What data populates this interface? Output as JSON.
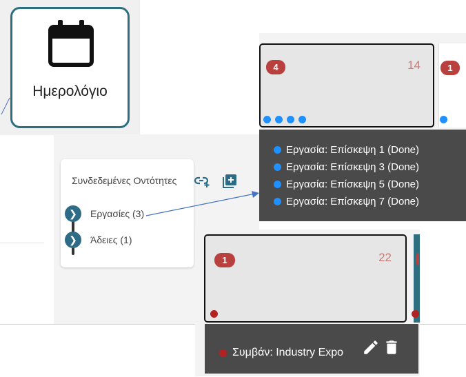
{
  "calendar_tile": {
    "label": "Ημερολόγιο",
    "icon": "calendar-icon"
  },
  "linked_entities": {
    "title": "Συνδεδεμένες Οντότητες",
    "items": [
      {
        "label": "Εργασίες (3)"
      },
      {
        "label": "Άδειες (1)"
      }
    ]
  },
  "calendar_cells": [
    {
      "badge": "4",
      "day": "14",
      "dots": 4,
      "dot_color": "#1e90ff",
      "popup": [
        "Εργασία: Επίσκεψη 1 (Done)",
        "Εργασία: Επίσκεψη 3 (Done)",
        "Εργασία: Επίσκεψη 5 (Done)",
        "Εργασία: Επίσκεψη 7 (Done)"
      ]
    },
    {
      "badge": "1",
      "day": "22",
      "dot_color": "#b22222",
      "event": "Συμβάν: Industry Expo"
    }
  ],
  "neighbor_badges": [
    "1"
  ],
  "colors": {
    "accent": "#2d6e80",
    "badge": "#b8413f",
    "task_dot": "#1e90ff",
    "event_dot": "#b22222",
    "popup_bg": "#4a4a4a"
  }
}
